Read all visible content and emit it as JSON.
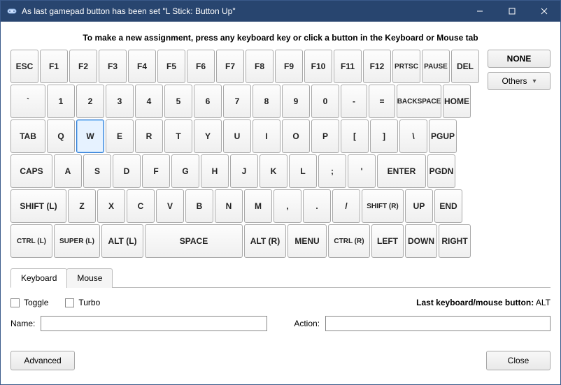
{
  "window": {
    "title": "As last gamepad button has been set \"L Stick: Button Up\""
  },
  "instruction": "To make a new assignment, press any keyboard key or click a button in the Keyboard or Mouse tab",
  "side": {
    "none_label": "NONE",
    "others_label": "Others"
  },
  "keys": {
    "row1": [
      "ESC",
      "F1",
      "F2",
      "F3",
      "F4",
      "F5",
      "F6",
      "F7",
      "F8",
      "F9",
      "F10",
      "F11",
      "F12",
      "PRTSC",
      "PAUSE",
      "DEL"
    ],
    "row2": [
      "`",
      "1",
      "2",
      "3",
      "4",
      "5",
      "6",
      "7",
      "8",
      "9",
      "0",
      "-",
      "=",
      "BACKSPACE",
      "HOME"
    ],
    "row3": [
      "TAB",
      "Q",
      "W",
      "E",
      "R",
      "T",
      "Y",
      "U",
      "I",
      "O",
      "P",
      "[",
      "]",
      "\\",
      "PGUP"
    ],
    "row4": [
      "CAPS",
      "A",
      "S",
      "D",
      "F",
      "G",
      "H",
      "J",
      "K",
      "L",
      ";",
      "'",
      "ENTER",
      "PGDN"
    ],
    "row5": [
      "SHIFT (L)",
      "Z",
      "X",
      "C",
      "V",
      "B",
      "N",
      "M",
      ",",
      ".",
      "/",
      "SHIFT (R)",
      "UP",
      "END"
    ],
    "row6": [
      "CTRL (L)",
      "SUPER (L)",
      "ALT (L)",
      "SPACE",
      "ALT (R)",
      "MENU",
      "CTRL (R)",
      "LEFT",
      "DOWN",
      "RIGHT"
    ]
  },
  "row_widths": {
    "row1": [
      40,
      40,
      40,
      40,
      40,
      40,
      40,
      40,
      40,
      40,
      40,
      40,
      40,
      40,
      40,
      40
    ],
    "row2": [
      50,
      40,
      40,
      40,
      40,
      40,
      40,
      40,
      40,
      40,
      40,
      38,
      38,
      64,
      40
    ],
    "row3": [
      50,
      40,
      40,
      40,
      40,
      40,
      40,
      40,
      40,
      40,
      40,
      40,
      40,
      40,
      40
    ],
    "row4": [
      60,
      40,
      40,
      40,
      40,
      40,
      40,
      40,
      40,
      40,
      40,
      40,
      70,
      40
    ],
    "row5": [
      80,
      40,
      40,
      40,
      40,
      40,
      40,
      40,
      40,
      40,
      40,
      60,
      40,
      40
    ],
    "row6": [
      60,
      66,
      60,
      140,
      60,
      56,
      60,
      46,
      46,
      46
    ]
  },
  "selected_key": "W",
  "tabs": {
    "keyboard": "Keyboard",
    "mouse": "Mouse",
    "active": "keyboard"
  },
  "checks": {
    "toggle": "Toggle",
    "turbo": "Turbo"
  },
  "last_button": {
    "label": "Last keyboard/mouse button:",
    "value": "ALT"
  },
  "fields": {
    "name_label": "Name:",
    "name_value": "",
    "action_label": "Action:",
    "action_value": ""
  },
  "footer": {
    "advanced": "Advanced",
    "close": "Close"
  }
}
